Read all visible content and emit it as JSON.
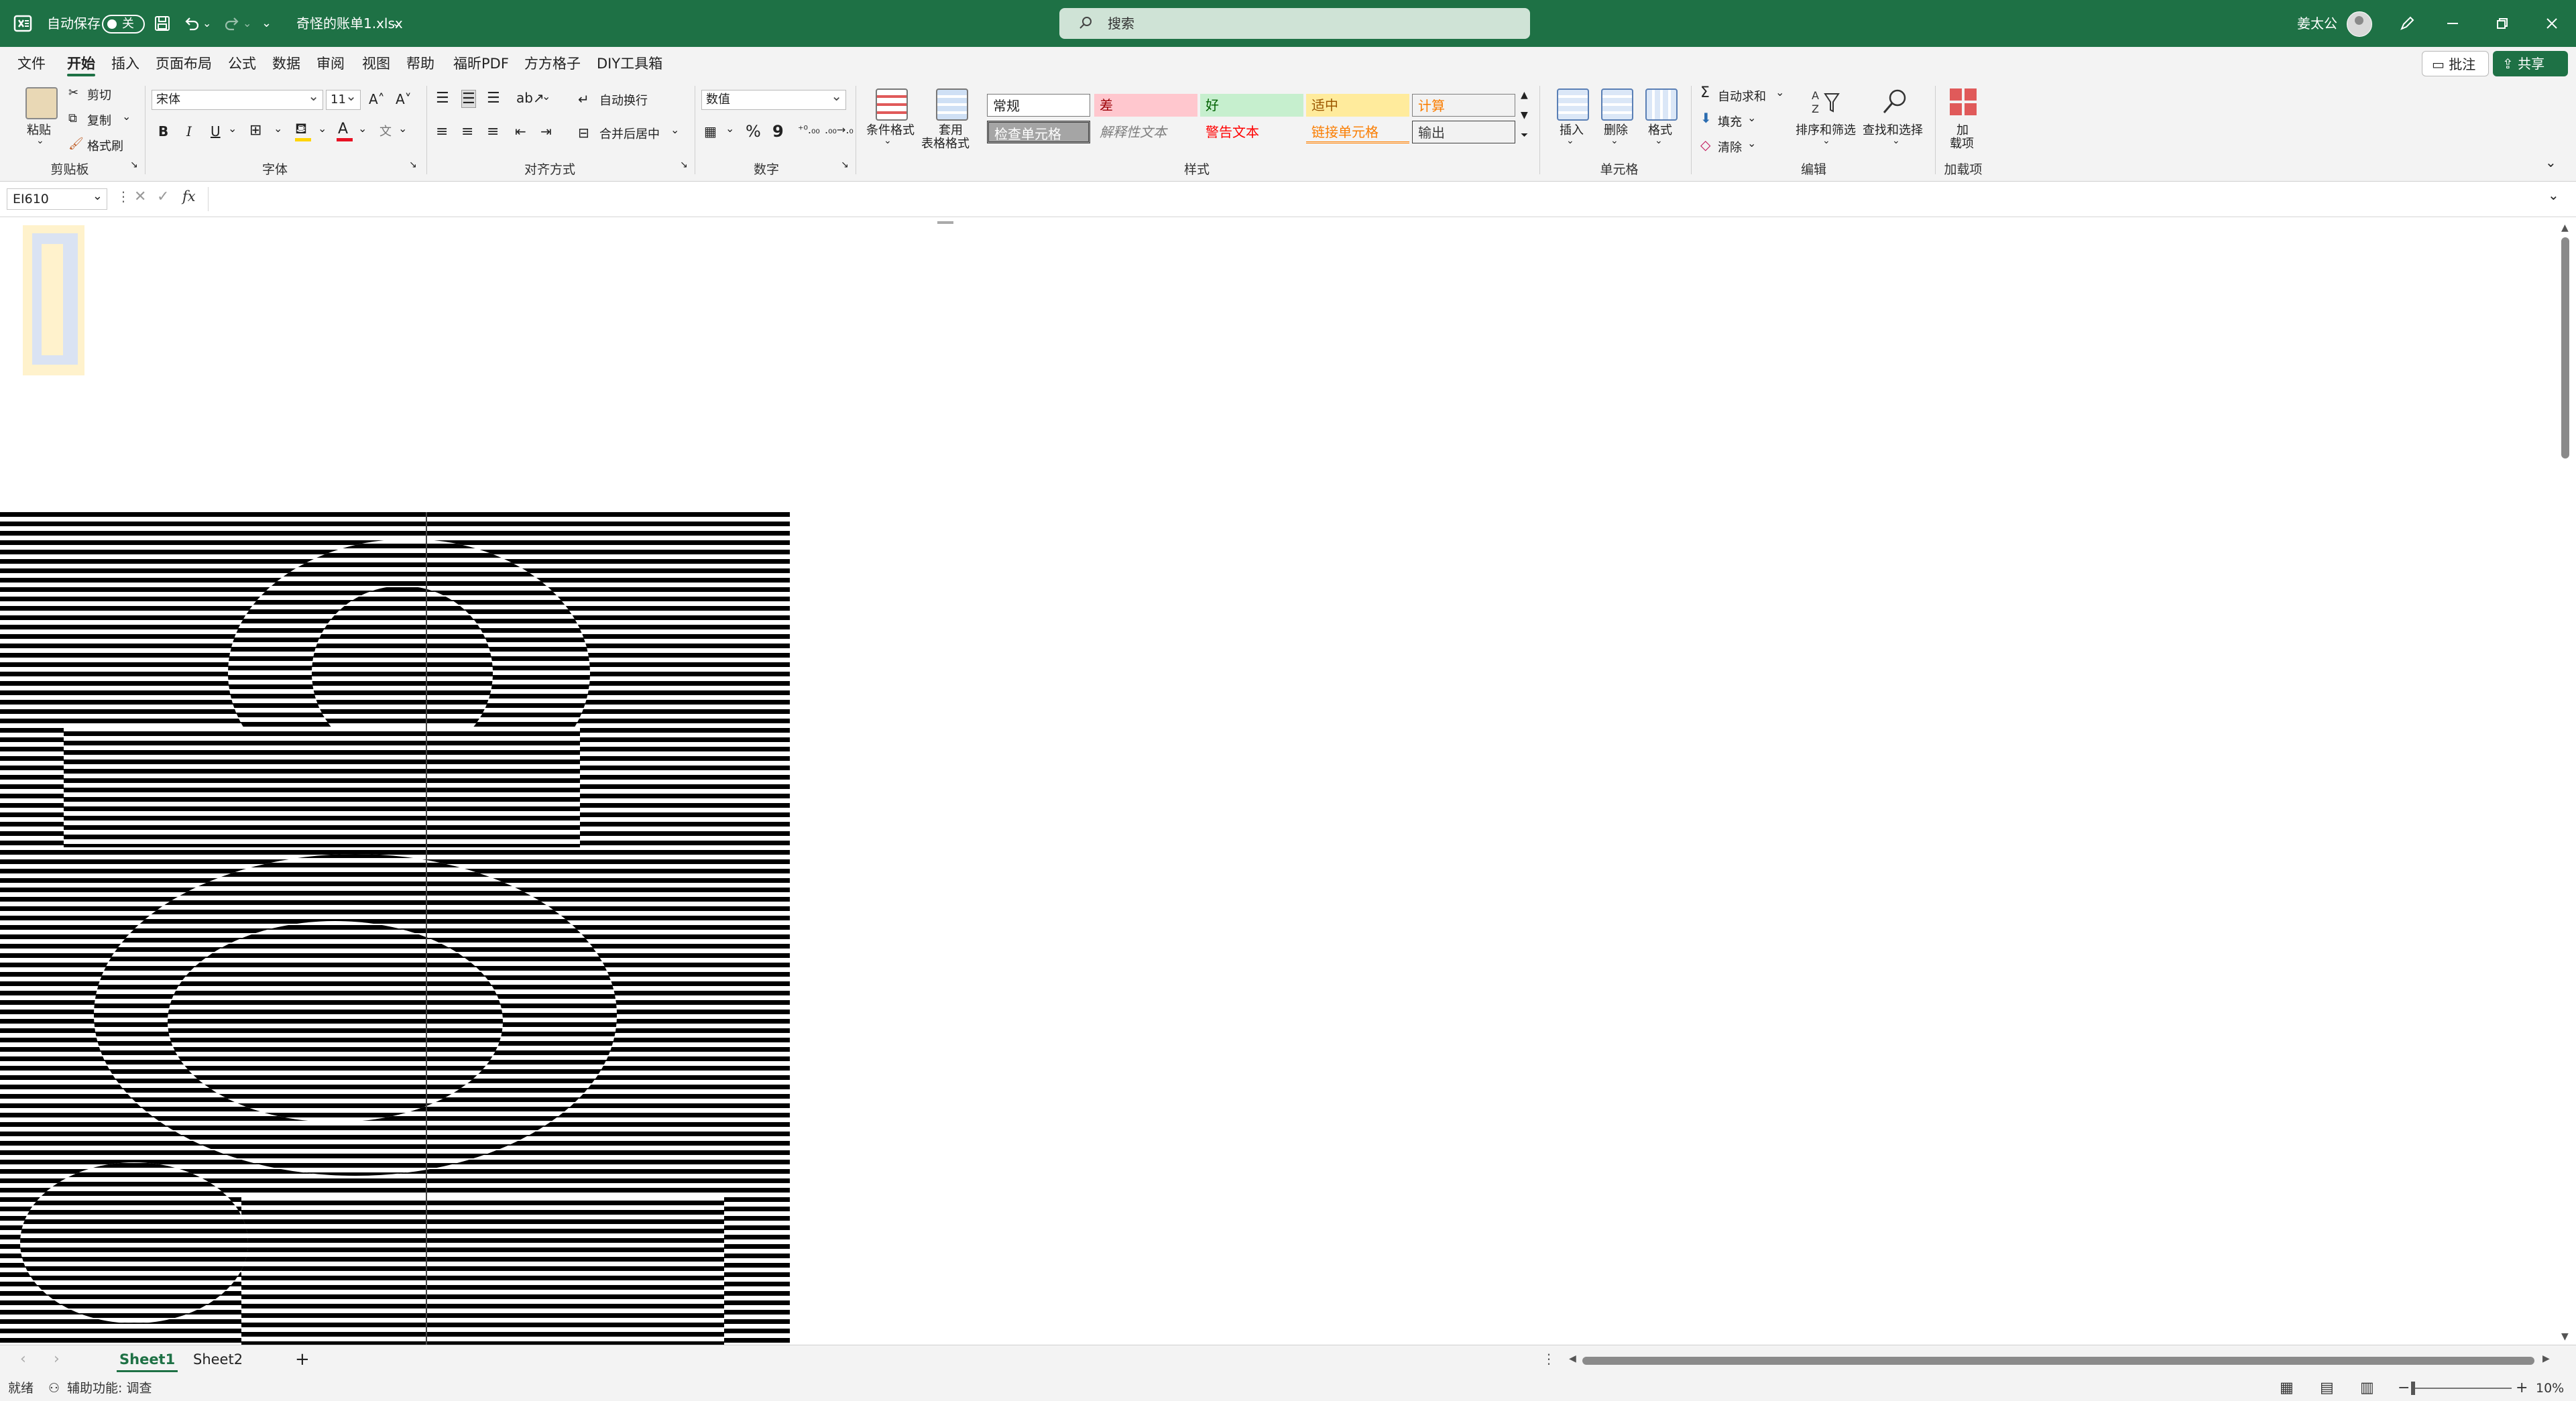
{
  "titlebar": {
    "autosave_label": "自动保存",
    "autosave_state": "关",
    "filename": "奇怪的账单1.xlsx",
    "search_placeholder": "搜索",
    "user_name": "姜太公",
    "accent_color": "#1e7145"
  },
  "menu": {
    "tabs": [
      "文件",
      "开始",
      "插入",
      "页面布局",
      "公式",
      "数据",
      "审阅",
      "视图",
      "帮助",
      "福昕PDF",
      "方方格子",
      "DIY工具箱"
    ],
    "active": "开始",
    "comment_label": "批注",
    "share_label": "共享"
  },
  "ribbon": {
    "clipboard": {
      "paste": "粘贴",
      "cut": "剪切",
      "copy": "复制",
      "format_painter": "格式刷",
      "label": "剪贴板"
    },
    "font": {
      "name": "宋体",
      "size": "11",
      "bold": "B",
      "italic": "I",
      "underline": "U",
      "label": "字体"
    },
    "alignment": {
      "wrap": "自动换行",
      "merge": "合并后居中",
      "label": "对齐方式"
    },
    "number": {
      "format": "数值",
      "percent": "%",
      "comma": "9",
      "label": "数字"
    },
    "styles": {
      "conditional": "条件格式",
      "table_format_1": "套用",
      "table_format_2": "表格格式",
      "cells": [
        "常规",
        "差",
        "好",
        "适中",
        "计算",
        "检查单元格",
        "解释性文本",
        "警告文本",
        "链接单元格",
        "输出"
      ],
      "label": "样式"
    },
    "cells": {
      "insert": "插入",
      "delete": "删除",
      "format": "格式",
      "label": "单元格"
    },
    "editing": {
      "autosum": "自动求和",
      "fill": "填充",
      "clear": "清除",
      "sort_filter": "排序和筛选",
      "find_select": "查找和选择",
      "label": "编辑"
    },
    "addins": {
      "addin_1": "加",
      "addin_2": "载项",
      "label": "加载项"
    }
  },
  "formula_bar": {
    "name_box": "EI610",
    "fx": "fx",
    "value": ""
  },
  "sheets": {
    "tabs": [
      "Sheet1",
      "Sheet2"
    ],
    "active": "Sheet1",
    "add": "+"
  },
  "status": {
    "ready": "就绪",
    "accessibility": "辅助功能: 调查",
    "zoom": "10%"
  }
}
